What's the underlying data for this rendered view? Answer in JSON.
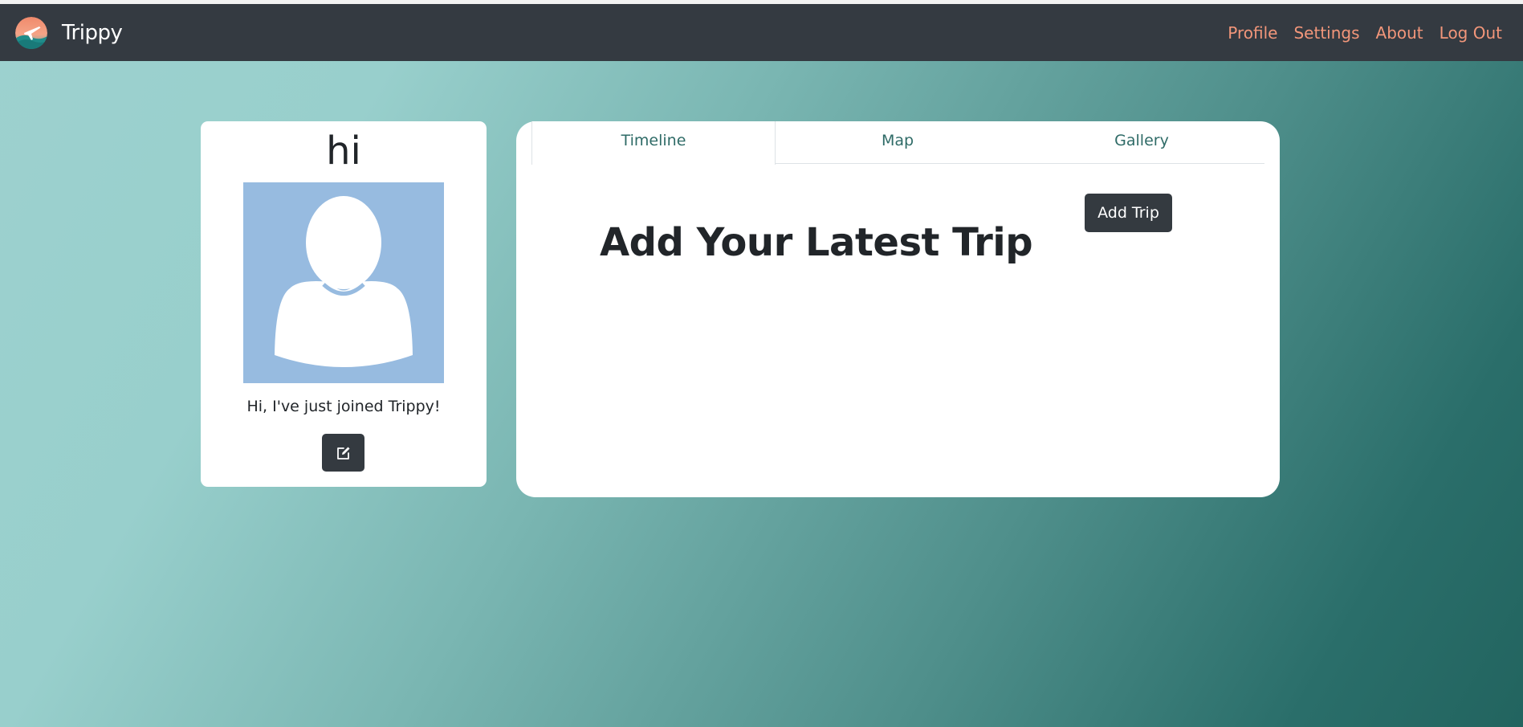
{
  "navbar": {
    "brand": "Trippy",
    "links": [
      "Profile",
      "Settings",
      "About",
      "Log Out"
    ]
  },
  "profile": {
    "name": "hi",
    "bio": "Hi, I've just joined Trippy!",
    "edit_icon": "edit-icon"
  },
  "tabs": [
    "Timeline",
    "Map",
    "Gallery"
  ],
  "active_tab": "Timeline",
  "main": {
    "heading": "Add Your Latest Trip",
    "add_trip_label": "Add Trip"
  },
  "colors": {
    "navbar_bg": "#343a41",
    "nav_link": "#f2967a",
    "tab_text": "#2f6b67",
    "button_bg": "#343a40",
    "avatar_bg": "#97bbe0"
  }
}
